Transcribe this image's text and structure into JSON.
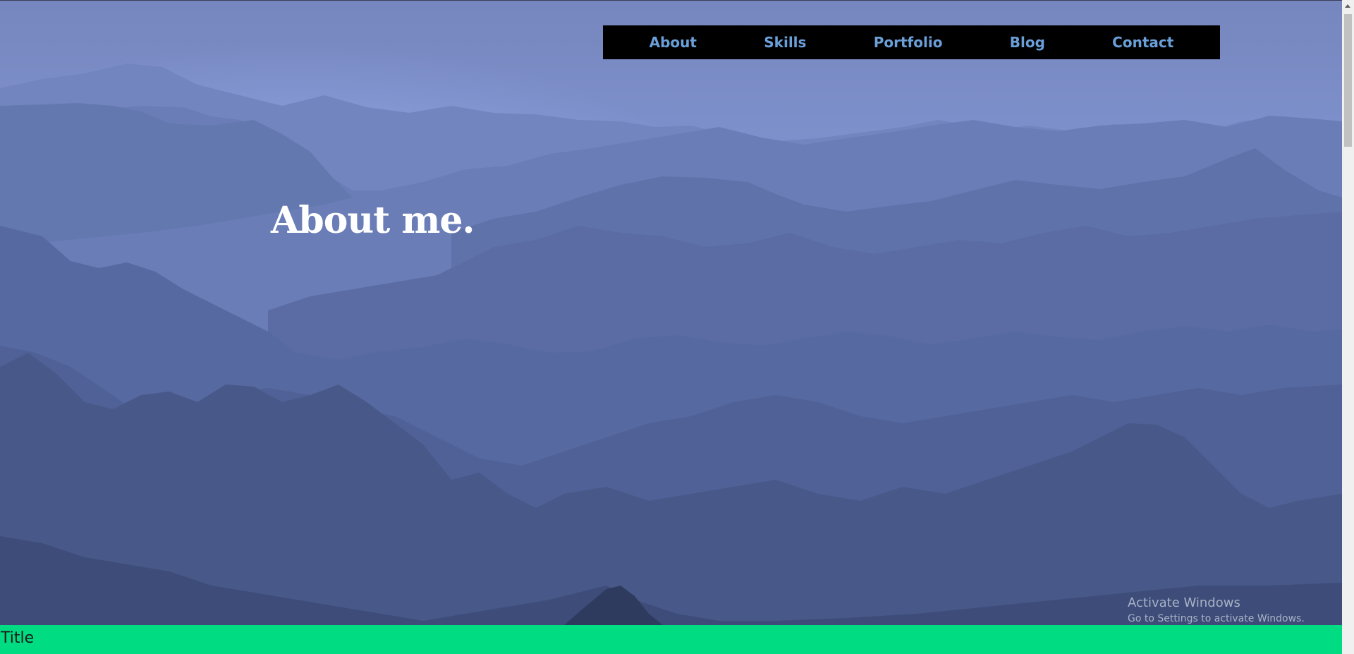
{
  "nav": {
    "items": [
      "About",
      "Skills",
      "Portfolio",
      "Blog",
      "Contact"
    ]
  },
  "hero": {
    "headline": "About me."
  },
  "overlay": {
    "activate_title": "Activate Windows",
    "activate_subtitle": "Go to Settings to activate Windows."
  },
  "footer": {
    "label": "Title"
  },
  "colors": {
    "nav_background": "#000000",
    "nav_link": "#6a9fd8",
    "footer_background": "#00dc82",
    "sky": "#7c91c9"
  }
}
